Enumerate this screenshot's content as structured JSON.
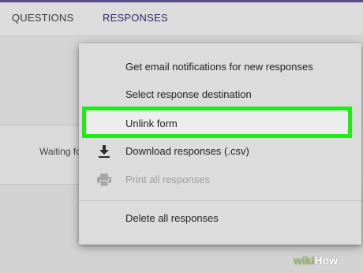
{
  "tabs": [
    {
      "label": "QUESTIONS",
      "active": false
    },
    {
      "label": "RESPONSES",
      "active": true
    }
  ],
  "status_text": "Waiting fo",
  "menu": {
    "items": [
      {
        "label": "Get email notifications for new responses",
        "icon": null,
        "disabled": false
      },
      {
        "label": "Select response destination",
        "icon": null,
        "disabled": false
      },
      {
        "label": "Unlink form",
        "icon": null,
        "disabled": false,
        "highlighted": true
      },
      {
        "label": "Download responses (.csv)",
        "icon": "download-icon",
        "disabled": false
      },
      {
        "label": "Print all responses",
        "icon": "printer-icon",
        "disabled": true
      },
      {
        "label": "Delete all responses",
        "icon": null,
        "disabled": false
      }
    ]
  },
  "watermark": {
    "prefix": "wiki",
    "suffix": "How"
  },
  "colors": {
    "accent": "#3b347e",
    "highlight_border": "#1cee12",
    "menu_bg": "#dcdcdc",
    "disabled_text": "#9e9e9e"
  }
}
